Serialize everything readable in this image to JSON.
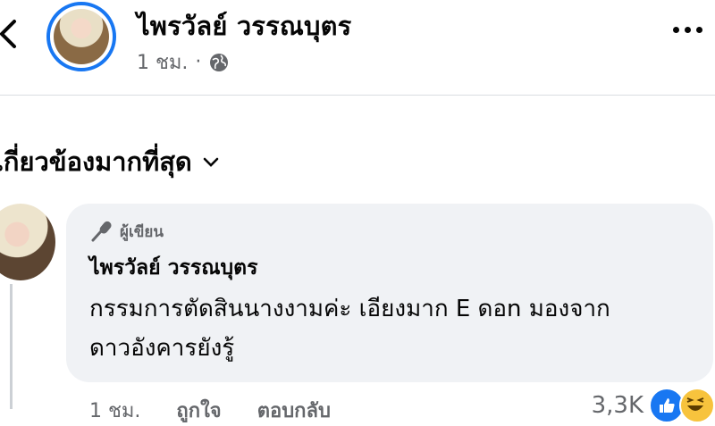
{
  "post": {
    "author_name": "ไพรวัลย์ วรรณบุตร",
    "time": "1 ชม.",
    "separator": "·",
    "privacy_icon": "globe-icon"
  },
  "filter": {
    "label": "เกี่ยวข้องมากที่สุด",
    "icon": "chevron-down-icon"
  },
  "comment": {
    "badge_label": "ผู้เขียน",
    "badge_icon": "microphone-icon",
    "author_name": "ไพรวัลย์ วรรณบุตร",
    "text_line1": "กรรมการตัดสินนางงามค่ะ เอียงมาก E ดอn มองจาก",
    "text_line2": "ดาวอังคารยังรู้",
    "time": "1 ชม.",
    "like_label": "ถูกใจ",
    "reply_label": "ตอบกลับ",
    "reaction_count": "3,3K",
    "reaction_icons": [
      "like-icon",
      "haha-icon"
    ]
  },
  "colors": {
    "accent": "#1877f2",
    "bubble_bg": "#f0f2f5",
    "secondary_text": "#65676b"
  }
}
